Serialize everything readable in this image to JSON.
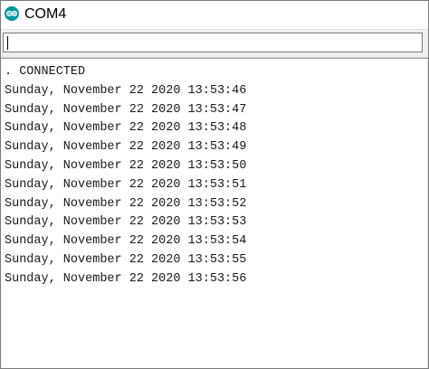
{
  "window": {
    "title": "COM4",
    "accent_color": "#00979C"
  },
  "send_field": {
    "value": "",
    "placeholder": ""
  },
  "serial_output": {
    "lines": [
      ". CONNECTED",
      "Sunday, November 22 2020 13:53:46",
      "Sunday, November 22 2020 13:53:47",
      "Sunday, November 22 2020 13:53:48",
      "Sunday, November 22 2020 13:53:49",
      "Sunday, November 22 2020 13:53:50",
      "Sunday, November 22 2020 13:53:51",
      "Sunday, November 22 2020 13:53:52",
      "Sunday, November 22 2020 13:53:53",
      "Sunday, November 22 2020 13:53:54",
      "Sunday, November 22 2020 13:53:55",
      "Sunday, November 22 2020 13:53:56"
    ]
  }
}
